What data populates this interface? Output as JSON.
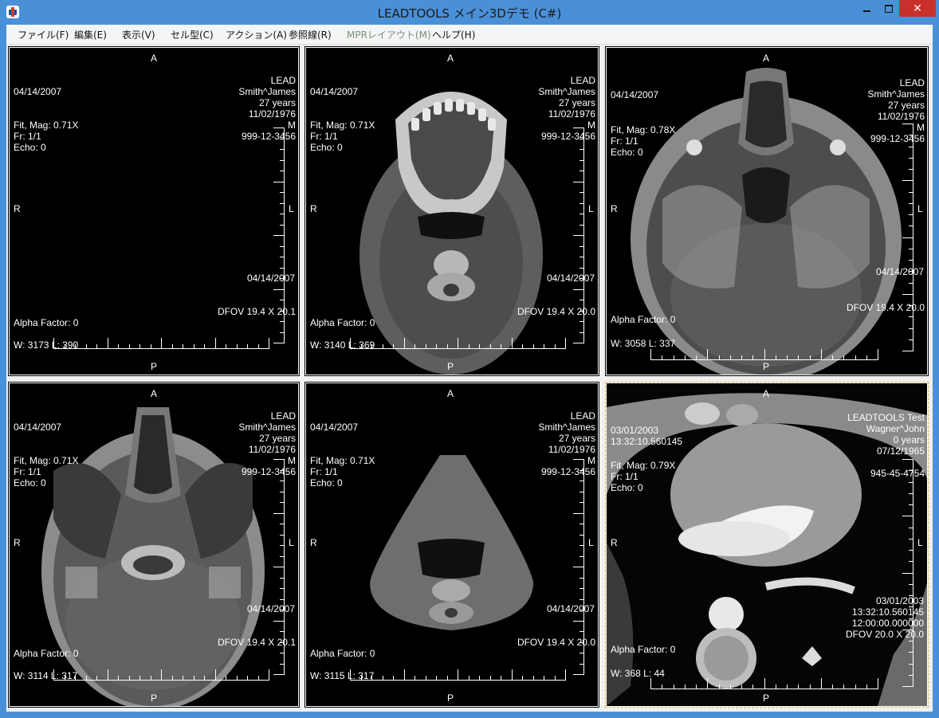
{
  "window": {
    "title": "LEADTOOLS メイン3Dデモ (C#)",
    "icon": "med-app-icon",
    "controls": {
      "minimize": "minimize-icon",
      "maximize": "maximize-icon",
      "close": "✕"
    }
  },
  "menu": {
    "items": [
      {
        "label": "ファイル(F)",
        "enabled": true
      },
      {
        "label": "編集(E)",
        "enabled": true
      },
      {
        "label": "表示(V)",
        "enabled": true
      },
      {
        "label": "セル型(C)",
        "enabled": true
      },
      {
        "label": "アクション(A)",
        "enabled": true
      },
      {
        "label": "参照線(R)",
        "enabled": true
      },
      {
        "label": "MPRレイアウト(M)",
        "enabled": false
      },
      {
        "label": "ヘルプ(H)",
        "enabled": true
      }
    ]
  },
  "cells": [
    {
      "top": "A",
      "bottom": "P",
      "left": "R",
      "right": "L",
      "date": "04/14/2007",
      "mag": "Fit, Mag: 0.71X",
      "frame": "Fr: 1/1",
      "echo": "Echo: 0",
      "patient": [
        "LEAD",
        "Smith^James",
        "27 years",
        "11/02/1976",
        "M",
        "999-12-3456"
      ],
      "study_date": "04/14/2007",
      "dfov": "DFOV 19.4 X 20.1",
      "alpha": "Alpha Factor: 0",
      "wl": "W: 3173 L: 390",
      "image": "empty"
    },
    {
      "top": "A",
      "bottom": "P",
      "left": "R",
      "right": "L",
      "date": "04/14/2007",
      "mag": "Fit, Mag: 0.71X",
      "frame": "Fr: 1/1",
      "echo": "Echo: 0",
      "patient": [
        "LEAD",
        "Smith^James",
        "27 years",
        "11/02/1976",
        "M",
        "999-12-3456"
      ],
      "study_date": "04/14/2007",
      "dfov": "DFOV 19.4 X 20.0",
      "alpha": "Alpha Factor: 0",
      "wl": "W: 3140 L: 369",
      "image": "ct-mandible-axial"
    },
    {
      "top": "A",
      "bottom": "P",
      "left": "R",
      "right": "L",
      "date": "04/14/2007",
      "mag": "Fit, Mag: 0.78X",
      "frame": "Fr: 1/1",
      "echo": "Echo: 0",
      "patient": [
        "LEAD",
        "Smith^James",
        "27 years",
        "11/02/1976",
        "M",
        "999-12-3456"
      ],
      "study_date": "04/14/2007",
      "dfov": "DFOV 19.4 X 20.0",
      "alpha": "Alpha Factor: 0",
      "wl": "W: 3058 L: 337",
      "image": "ct-skull-base-axial"
    },
    {
      "top": "A",
      "bottom": "P",
      "left": "R",
      "right": "L",
      "date": "04/14/2007",
      "mag": "Fit, Mag: 0.71X",
      "frame": "Fr: 1/1",
      "echo": "Echo: 0",
      "patient": [
        "LEAD",
        "Smith^James",
        "27 years",
        "11/02/1976",
        "M",
        "999-12-3456"
      ],
      "study_date": "04/14/2007",
      "dfov": "DFOV 19.4 X 20.1",
      "alpha": "Alpha Factor: 0",
      "wl": "W: 3114 L: 317",
      "image": "ct-skull-base-axial-2"
    },
    {
      "top": "A",
      "bottom": "P",
      "left": "R",
      "right": "L",
      "date": "04/14/2007",
      "mag": "Fit, Mag: 0.71X",
      "frame": "Fr: 1/1",
      "echo": "Echo: 0",
      "patient": [
        "LEAD",
        "Smith^James",
        "27 years",
        "11/02/1976",
        "M",
        "999-12-3456"
      ],
      "study_date": "04/14/2007",
      "dfov": "DFOV 19.4 X 20.0",
      "alpha": "Alpha Factor: 0",
      "wl": "W: 3115 L: 317",
      "image": "ct-neck-axial"
    },
    {
      "top": "A",
      "bottom": "P",
      "left": "R",
      "right": "L",
      "date": "03/01/2003",
      "time": "13:32:10.560145",
      "mag": "Fit, Mag: 0.79X",
      "frame": "Fr: 1/1",
      "echo": "Echo: 0",
      "patient": [
        "LEADTOOLS Test",
        "Wagner^John",
        "0 years",
        "07/12/1965",
        "945-45-4754"
      ],
      "study_date": "03/01/2003",
      "study_time": "13:32:10.560145",
      "study_time2": "12:00:00.000000",
      "dfov": "DFOV 20.0 X 20.0",
      "alpha": "Alpha Factor: 0",
      "wl": "W: 368 L: 44",
      "image": "ct-chest-axial",
      "selected": true
    }
  ]
}
